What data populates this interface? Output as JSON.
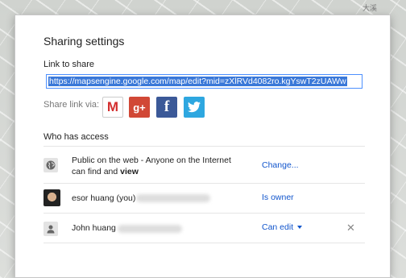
{
  "map": {
    "corner_label": "大溪"
  },
  "dialog": {
    "title": "Sharing settings",
    "link_label": "Link to share",
    "link_value": "https://mapsengine.google.com/map/edit?mid=zXlRVd4082ro.kgYswT2zUAWw",
    "share_via_label": "Share link via:",
    "share_targets": [
      {
        "name": "Gmail",
        "glyph": "M",
        "color": "#d32f2f"
      },
      {
        "name": "Google+",
        "glyph": "g+",
        "color": "#d14836"
      },
      {
        "name": "Facebook",
        "glyph": "f",
        "color": "#3b5998"
      },
      {
        "name": "Twitter",
        "glyph": "🐦",
        "color": "#2ea7e0"
      }
    ],
    "who_label": "Who has access",
    "access": [
      {
        "icon": "globe-icon",
        "text_line1": "Public on the web - Anyone on the Internet",
        "text_line2_prefix": "can find and ",
        "text_line2_bold": "view",
        "action": "Change..."
      },
      {
        "icon": "avatar",
        "name": "esor huang (you)",
        "action": "Is owner"
      },
      {
        "icon": "person-icon",
        "name": "John huang",
        "action": "Can edit"
      }
    ]
  }
}
